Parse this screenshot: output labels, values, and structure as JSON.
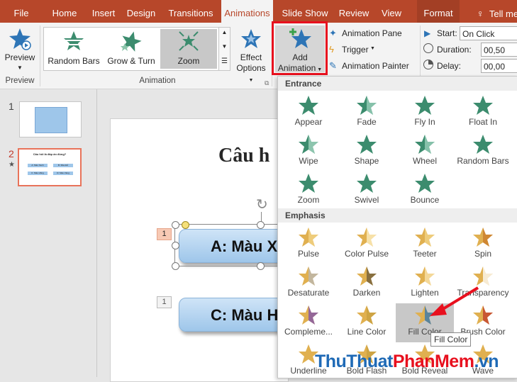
{
  "tabs": [
    "File",
    "Home",
    "Insert",
    "Design",
    "Transitions",
    "Animations",
    "Slide Show",
    "Review",
    "View",
    "Format",
    "Tell me"
  ],
  "active_tab": "Animations",
  "ribbon": {
    "preview_label": "Preview",
    "preview_group": "Preview",
    "effects": [
      "Random Bars",
      "Grow & Turn",
      "Zoom"
    ],
    "effect_options": [
      "Effect",
      "Options"
    ],
    "animation_group": "Animation",
    "add_animation": [
      "Add",
      "Animation"
    ],
    "animation_pane": "Animation Pane",
    "trigger": "Trigger",
    "animation_painter": "Animation Painter",
    "start_label": "Start:",
    "start_value": "On Click",
    "duration_label": "Duration:",
    "duration_value": "00,50",
    "delay_label": "Delay:",
    "delay_value": "00,00"
  },
  "slides": {
    "numbers": [
      "1",
      "2"
    ],
    "thumb2_title": "Câu hỏi là đáp án đúng?",
    "thumb2_options": [
      "A: Màu Xanh",
      "B: Màu Đỏ",
      "C: Màu Hồng",
      "D: Màu Vàng"
    ]
  },
  "slide": {
    "title": "Câu h",
    "option_a": "A: Màu X",
    "option_c": "C: Màu H",
    "tag_a": "1",
    "tag_c": "1"
  },
  "gallery": {
    "entrance_header": "Entrance",
    "entrance": [
      "Appear",
      "Fade",
      "Fly In",
      "Float In",
      "Wipe",
      "Shape",
      "Wheel",
      "Random Bars",
      "Zoom",
      "Swivel",
      "Bounce"
    ],
    "emphasis_header": "Emphasis",
    "emphasis": [
      "Pulse",
      "Color Pulse",
      "Teeter",
      "Spin",
      "Desaturate",
      "Darken",
      "Lighten",
      "Transparency",
      "Compleme...",
      "Line Color",
      "Fill Color",
      "Brush Color",
      "Underline",
      "Bold Flash",
      "Bold Reveal",
      "Wave"
    ],
    "tooltip": "Fill Color"
  },
  "watermark": {
    "part1": "ThuThuat",
    "part2": "PhanMem",
    "part3": ".vn"
  },
  "colors": {
    "accent": "#b7472a",
    "entrance_star": "#3c8c6e",
    "emphasis_star": "#e0b050",
    "highlight_box": "#e8101e"
  }
}
